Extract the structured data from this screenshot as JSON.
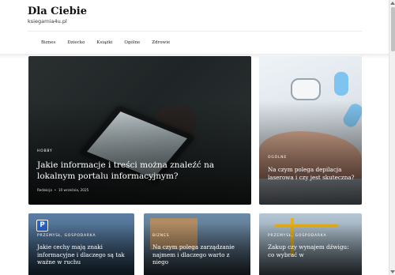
{
  "site": {
    "title": "Dla Ciebie",
    "subtitle": "ksiegarnia4u.pl"
  },
  "nav": {
    "items": [
      "Biznes",
      "Dziecko",
      "Książki",
      "Ogólne",
      "Zdrowie"
    ]
  },
  "cards": [
    {
      "category": "HOBBY",
      "title": "Jakie informacje i treści można znaleźć na lokalnym portalu informacyjnym?",
      "author": "Redakcja",
      "date": "10 września, 2025"
    },
    {
      "category": "OGÓLNE",
      "title": "Na czym polega depilacja laserowa i czy jest skuteczna?"
    },
    {
      "category": "PRZEMYSŁ, GOSPODARKA",
      "title": "Jakie cechy mają znaki informacyjne i dlaczego są tak ważne w ruchu"
    },
    {
      "category": "BIZNES",
      "title": "Na czym polega zarządzanie najmem i dlaczego warto z niego"
    },
    {
      "category": "PRZEMYSŁ, GOSPODARKA",
      "title": "Zakup czy wynajem dźwigu: co wybrać w"
    }
  ],
  "icons": {
    "sign_glyph": "P"
  }
}
